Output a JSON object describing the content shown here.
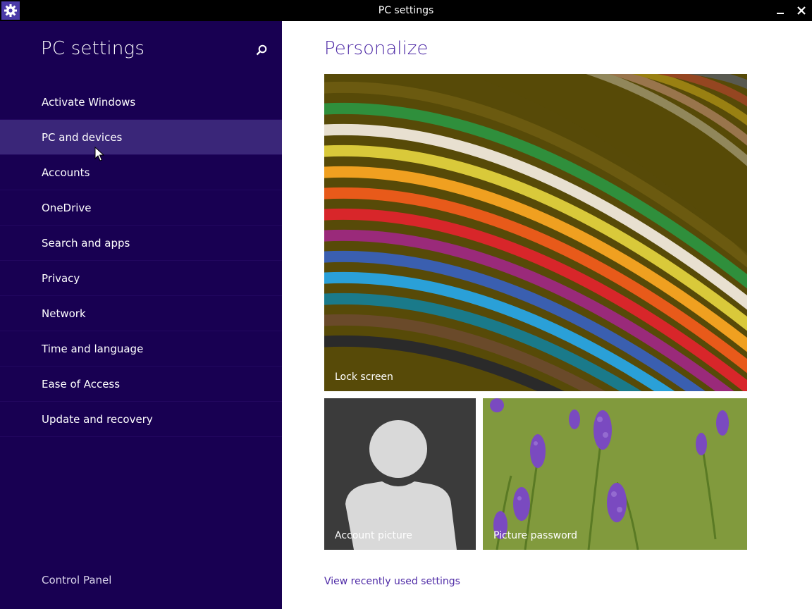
{
  "window": {
    "title": "PC settings",
    "icons": {
      "app": "gear-icon",
      "minimize": "minimize-icon",
      "close": "close-icon"
    }
  },
  "sidebar": {
    "title": "PC settings",
    "search_icon": "search-icon",
    "items": [
      {
        "label": "Activate Windows"
      },
      {
        "label": "PC and devices"
      },
      {
        "label": "Accounts"
      },
      {
        "label": "OneDrive"
      },
      {
        "label": "Search and apps"
      },
      {
        "label": "Privacy"
      },
      {
        "label": "Network"
      },
      {
        "label": "Time and language"
      },
      {
        "label": "Ease of Access"
      },
      {
        "label": "Update and recovery"
      }
    ],
    "footer_link": "Control Panel"
  },
  "main": {
    "title": "Personalize",
    "tiles": {
      "lock_screen": "Lock screen",
      "account_picture": "Account picture",
      "picture_password": "Picture password"
    },
    "recent_link": "View recently used settings"
  },
  "colors": {
    "sidebar_bg": "#180052",
    "sidebar_hover": "#3a2679",
    "accent": "#4e2aa6",
    "titlebar_bg": "#000000"
  }
}
